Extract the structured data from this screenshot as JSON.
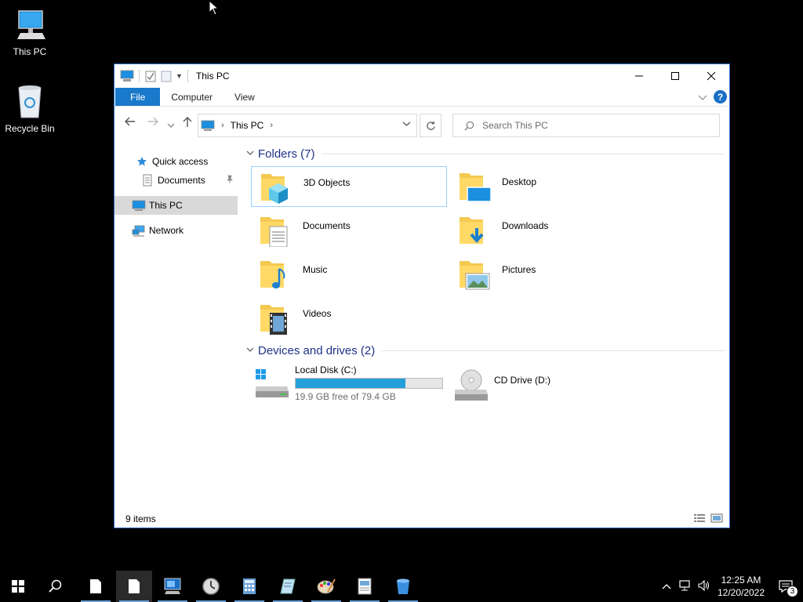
{
  "desktop": {
    "icons": [
      {
        "label": "This PC"
      },
      {
        "label": "Recycle Bin"
      }
    ]
  },
  "window": {
    "title": "This PC",
    "ribbon": {
      "tabs": [
        "File",
        "Computer",
        "View"
      ]
    },
    "address": {
      "crumb": "This PC"
    },
    "search": {
      "placeholder": "Search This PC"
    },
    "nav_pane": {
      "quick_access": "Quick access",
      "documents": "Documents",
      "this_pc": "This PC",
      "network": "Network"
    },
    "folders_group": "Folders (7)",
    "folders": [
      {
        "name": "3D Objects"
      },
      {
        "name": "Desktop"
      },
      {
        "name": "Documents"
      },
      {
        "name": "Downloads"
      },
      {
        "name": "Music"
      },
      {
        "name": "Pictures"
      },
      {
        "name": "Videos"
      }
    ],
    "drives_group": "Devices and drives (2)",
    "drives": [
      {
        "name": "Local Disk (C:)",
        "free": "19.9 GB free of 79.4 GB",
        "used_fraction": 0.749
      },
      {
        "name": "CD Drive (D:)"
      }
    ],
    "status": "9 items"
  },
  "taskbar": {
    "time": "12:25 AM",
    "date": "12/20/2022",
    "notifications": "3"
  },
  "colors": {
    "accent": "#1979ca",
    "folder": "#f4c950",
    "progress": "#26a0da"
  }
}
